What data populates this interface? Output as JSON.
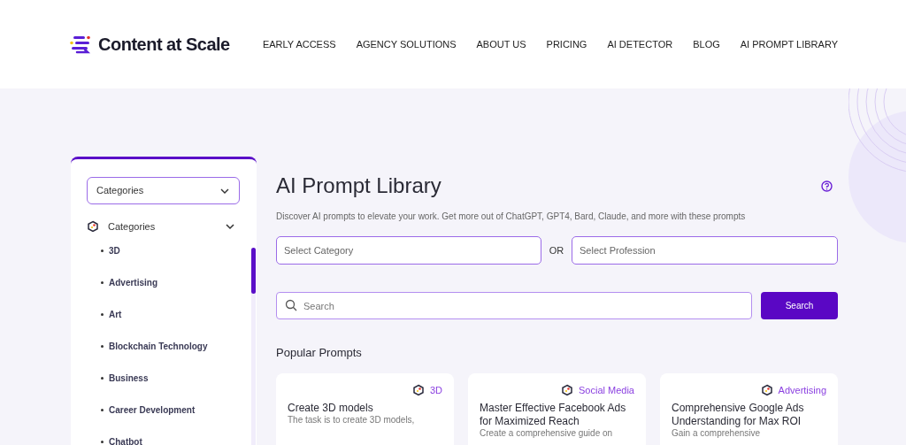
{
  "header": {
    "brand": "Content at Scale",
    "nav": [
      {
        "label": "EARLY ACCESS"
      },
      {
        "label": "AGENCY SOLUTIONS"
      },
      {
        "label": "ABOUT US"
      },
      {
        "label": "PRICING"
      },
      {
        "label": "AI DETECTOR"
      },
      {
        "label": "BLOG"
      },
      {
        "label": "AI PROMPT LIBRARY"
      }
    ]
  },
  "sidebar": {
    "dropdown": "Categories",
    "section": {
      "label": "Categories",
      "expanded": true,
      "items": [
        "3D",
        "Advertising",
        "Art",
        "Blockchain Technology",
        "Business",
        "Career Development",
        "Chatbot"
      ]
    }
  },
  "main": {
    "title": "AI Prompt Library",
    "subtitle": "Discover AI prompts to elevate your work. Get more out of ChatGPT, GPT4, Bard, Claude, and more with these prompts",
    "category_placeholder": "Select Category",
    "or": "OR",
    "profession_placeholder": "Select Profession",
    "search_placeholder": "Search",
    "search_button": "Search",
    "popular_heading": "Popular Prompts",
    "cards": [
      {
        "tag": "3D",
        "title": "Create 3D models",
        "description": "The task is to create 3D models,"
      },
      {
        "tag": "Social Media",
        "title": "Master Effective Facebook Ads for Maximized Reach",
        "description": "Create a comprehensive guide on"
      },
      {
        "tag": "Advertising",
        "title": "Comprehensive Google Ads Understanding for Max ROI",
        "description": "Gain a comprehensive"
      }
    ]
  }
}
